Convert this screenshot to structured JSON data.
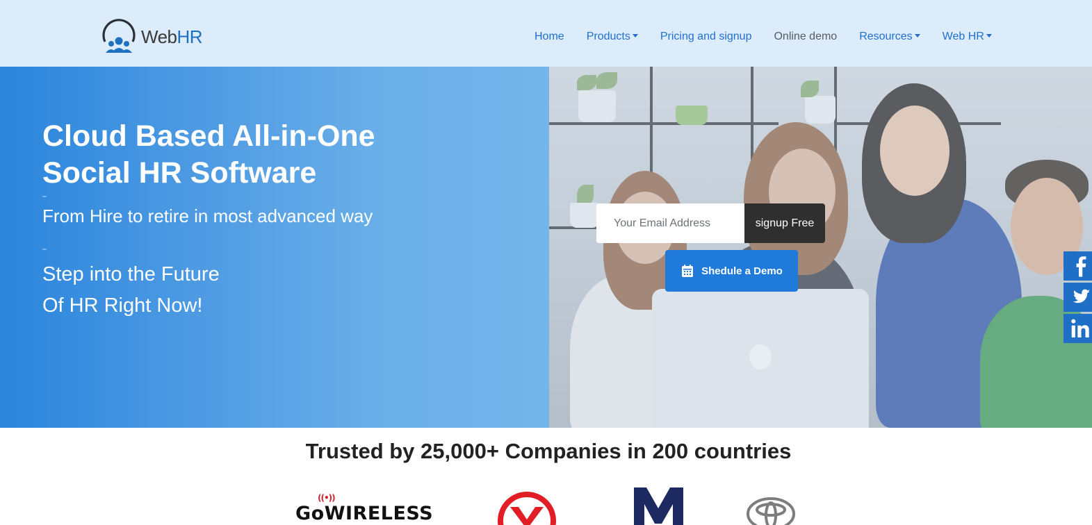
{
  "brand": {
    "name_prefix": "Web",
    "name_suffix": "HR",
    "accent_color": "#1f6fd0",
    "header_bg": "#dcecfb"
  },
  "nav": {
    "items": [
      {
        "label": "Home",
        "has_dropdown": false
      },
      {
        "label": "Products",
        "has_dropdown": true
      },
      {
        "label": "Pricing and signup",
        "has_dropdown": false
      },
      {
        "label": "Online demo",
        "has_dropdown": false
      },
      {
        "label": "Resources",
        "has_dropdown": true
      },
      {
        "label": "Web HR",
        "has_dropdown": true
      }
    ]
  },
  "hero": {
    "title_line1": "Cloud Based All-in-One",
    "title_line2": "Social HR Software",
    "subtitle": "From Hire to retire in most advanced way",
    "step_line1": "Step into the Future",
    "step_line2": "Of HR Right Now!"
  },
  "signup": {
    "email_placeholder": "Your Email Address",
    "email_value": "",
    "button_label": "signup Free",
    "demo_label": "Shedule a Demo",
    "demo_icon": "calendar-icon"
  },
  "social": {
    "items": [
      {
        "name": "facebook",
        "icon": "facebook-icon"
      },
      {
        "name": "twitter",
        "icon": "twitter-icon"
      },
      {
        "name": "linkedin",
        "icon": "linkedin-icon"
      }
    ],
    "color": "#1f6fc6"
  },
  "trusted": {
    "heading": "Trusted by 25,000+ Companies in 200 countries",
    "logos": {
      "gowireless": "GoWIRELESS",
      "gowireless_signal": "((•))"
    }
  }
}
